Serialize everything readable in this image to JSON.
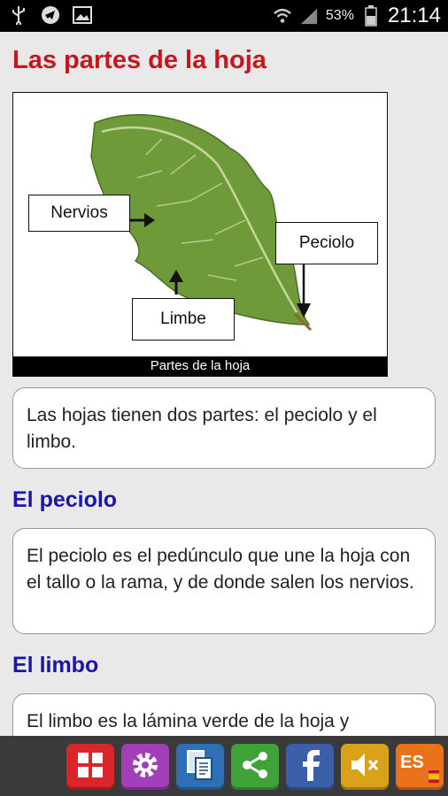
{
  "status_bar": {
    "battery_percent": "53%",
    "time": "21:14",
    "icons": [
      "usb-icon",
      "telegram-icon",
      "image-icon",
      "wifi-icon",
      "signal-icon",
      "battery-icon"
    ]
  },
  "page": {
    "title": "Las partes de la hoja",
    "figure": {
      "caption": "Partes de la hoja",
      "labels": {
        "nervios": "Nervios",
        "peciolo": "Peciolo",
        "limbe": "Limbe"
      }
    },
    "intro_text": "Las hojas tienen dos partes: el peciolo y el limbo.",
    "sections": [
      {
        "heading": "El peciolo",
        "text": "El peciolo es el pedúnculo que une la hoja con el tallo o la rama, y de donde salen los nervios."
      },
      {
        "heading": "El limbo",
        "text": "El limbo es la lámina verde de la hoja y"
      }
    ]
  },
  "toolbar": {
    "buttons": [
      {
        "name": "menu-grid-icon",
        "color": "#d8262b"
      },
      {
        "name": "settings-gear-icon",
        "color": "#a23fb8"
      },
      {
        "name": "copy-documents-icon",
        "color": "#2e6fb5"
      },
      {
        "name": "share-icon",
        "color": "#3fa33a"
      },
      {
        "name": "facebook-icon",
        "color": "#3b5fa8"
      },
      {
        "name": "sound-muted-icon",
        "color": "#d9a21a"
      },
      {
        "name": "language-es-icon",
        "color": "#e8731c",
        "label": "ES"
      }
    ]
  }
}
